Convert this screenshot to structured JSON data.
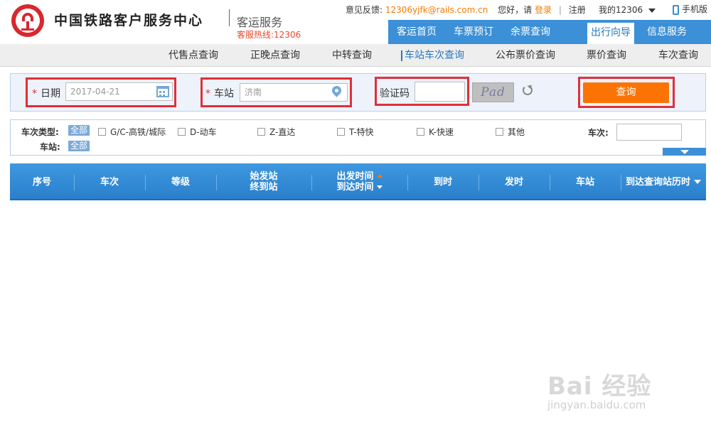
{
  "header": {
    "brand": "中国铁路客户服务中心",
    "sub_brand": "客运服务",
    "hotline": "客服热线:12306",
    "feedback_label": "意见反馈:",
    "feedback_email": "12306yjfk@rails.com.cn",
    "greeting": "您好，请",
    "login": "登录",
    "register": "注册",
    "my12306": "我的12306",
    "mobile": "手机版"
  },
  "main_nav": [
    "客运首页",
    "车票预订",
    "余票查询",
    "出行向导",
    "信息服务"
  ],
  "main_nav_active": "出行向导",
  "sub_nav": [
    "代售点查询",
    "正晚点查询",
    "中转查询",
    "车站车次查询",
    "公布票价查询",
    "票价查询",
    "车次查询"
  ],
  "sub_nav_active": "车站车次查询",
  "query": {
    "date_label": "日期",
    "date_value": "2017-04-21",
    "station_label": "车站",
    "station_value": "济南",
    "captcha_label": "验证码",
    "captcha_value": "",
    "captcha_image_text": "Pad",
    "submit_label": "查询"
  },
  "filters": {
    "train_type_label": "车次类型:",
    "all_label": "全部",
    "types": [
      "G/C-高铁/城际",
      "D-动车",
      "Z-直达",
      "T-特快",
      "K-快速",
      "其他"
    ],
    "train_no_label": "车次:",
    "station_label": "车站:",
    "station_all_label": "全部"
  },
  "table": {
    "headers": [
      "序号",
      "车次",
      "等级",
      "始发站",
      "终到站",
      "出发时间",
      "到达时间",
      "到时",
      "发时",
      "车站",
      "到达查询站历时"
    ]
  },
  "watermark": {
    "main": "Bai 经验",
    "sub": "jingyan.baidu.com"
  },
  "colors": {
    "nav_blue": "#3b90d7",
    "accent_orange": "#fb7403",
    "highlight_red": "#e02f3b"
  }
}
